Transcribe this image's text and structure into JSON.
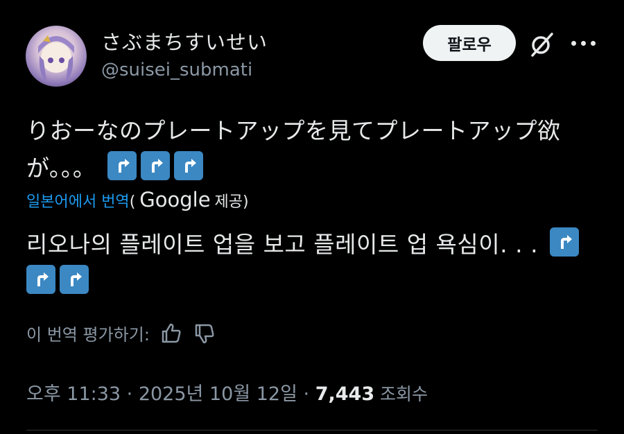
{
  "author": {
    "display_name": "さぶまちすいせい",
    "handle": "@suisei_submati"
  },
  "follow_button": {
    "label": "팔로우"
  },
  "icons": {
    "grok": "grok-icon",
    "more": "more-icon",
    "arrow": "arrow-up-right-icon",
    "thumbs_up": "thumbs-up-icon",
    "thumbs_down": "thumbs-down-icon"
  },
  "tweet": {
    "line1": "りおーなのプレートアップを見てプレートアップ欲",
    "line2": "が。。。"
  },
  "translation": {
    "link": "일본어에서 번역",
    "paren_open": "(",
    "provider": "Google",
    "provided": "제공)",
    "text": "리오나의 플레이트 업을 보고 플레이트 업 욕심이. . ."
  },
  "rating": {
    "label": "이 번역 평가하기:"
  },
  "meta": {
    "time": "오후 11:33",
    "sep1": " · ",
    "date": "2025년 10월 12일",
    "sep2": " · ",
    "views": "7,443",
    "views_label": " 조회수"
  },
  "colors": {
    "background": "#000000",
    "text": "#e7e9ea",
    "muted": "#8b98a5",
    "link": "#1d9bf0",
    "arrow_emoji": "#3b88c3"
  }
}
